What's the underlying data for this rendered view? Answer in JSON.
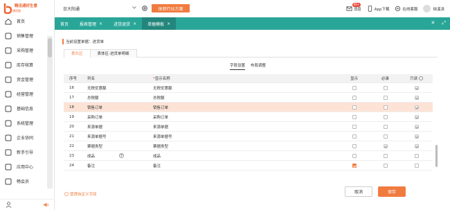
{
  "brand": {
    "name": "精迅通好生意",
    "sub": "通用版"
  },
  "sidebar": {
    "items": [
      {
        "label": "首页",
        "icon": "home-icon"
      },
      {
        "label": "销售管理",
        "icon": "sales-icon"
      },
      {
        "label": "采购管理",
        "icon": "purchase-icon"
      },
      {
        "label": "库存核算",
        "icon": "inventory-icon"
      },
      {
        "label": "资金管理",
        "icon": "wallet-icon"
      },
      {
        "label": "经营管理",
        "icon": "chart-icon"
      },
      {
        "label": "基础信息",
        "icon": "info-icon"
      },
      {
        "label": "系统管理",
        "icon": "gear-icon"
      },
      {
        "label": "企业协同",
        "icon": "handshake-icon"
      },
      {
        "label": "新手引导",
        "icon": "guide-icon"
      },
      {
        "label": "应用中心",
        "icon": "apps-icon"
      },
      {
        "label": "畅会员",
        "icon": "member-icon"
      }
    ]
  },
  "topbar": {
    "company": "日大阳通",
    "experience_button": "体验行业方案",
    "message_label": "消息",
    "message_badge": "99+",
    "app_label": "App下载",
    "service_label": "在线客服",
    "user_name": "徐溪泽"
  },
  "tabs": [
    {
      "label": "首页",
      "closable": false,
      "active": false
    },
    {
      "label": "报表管理",
      "closable": true,
      "active": false
    },
    {
      "label": "进货退货",
      "closable": true,
      "active": false
    },
    {
      "label": "单据模板",
      "closable": true,
      "active": true
    }
  ],
  "panel": {
    "title": "当前设置单据：进货单",
    "section_tabs": [
      "表头区",
      "表体区-进货单明细"
    ],
    "sub_tabs": [
      "字段设置",
      "布局调整"
    ],
    "columns": {
      "no": "序号",
      "name": "列名",
      "display": "显示名称",
      "show": "显示",
      "required": "必录",
      "readonly": "只读"
    },
    "rows": [
      {
        "no": "16",
        "name": "无税优惠额",
        "display": "无税优惠额",
        "show": false,
        "req": false,
        "ro": true
      },
      {
        "no": "17",
        "name": "总税额",
        "display": "总税额",
        "show": false,
        "req": false,
        "ro": true
      },
      {
        "no": "18",
        "name": "销售订单",
        "display": "销售订单",
        "show": false,
        "req": false,
        "ro": true,
        "highlight": true
      },
      {
        "no": "19",
        "name": "采购订单",
        "display": "采购订单",
        "show": false,
        "req": false,
        "ro": true
      },
      {
        "no": "20",
        "name": "来源单据",
        "display": "来源单据",
        "show": false,
        "req": false,
        "ro": true
      },
      {
        "no": "21",
        "name": "来源单据号",
        "display": "来源单据号",
        "show": false,
        "req": false,
        "ro": true
      },
      {
        "no": "22",
        "name": "票据类型",
        "display": "票据类型",
        "show": false,
        "req": true,
        "ro": true
      },
      {
        "no": "23",
        "name": "成品",
        "display": "成品",
        "show": false,
        "req": false,
        "ro": false,
        "plus": true
      },
      {
        "no": "24",
        "name": "备注",
        "display": "备注",
        "show": true,
        "req": false,
        "ro": false,
        "show_orange": true
      }
    ],
    "footer_link": "管理自定义字段",
    "cancel": "取消",
    "save": "保存"
  }
}
